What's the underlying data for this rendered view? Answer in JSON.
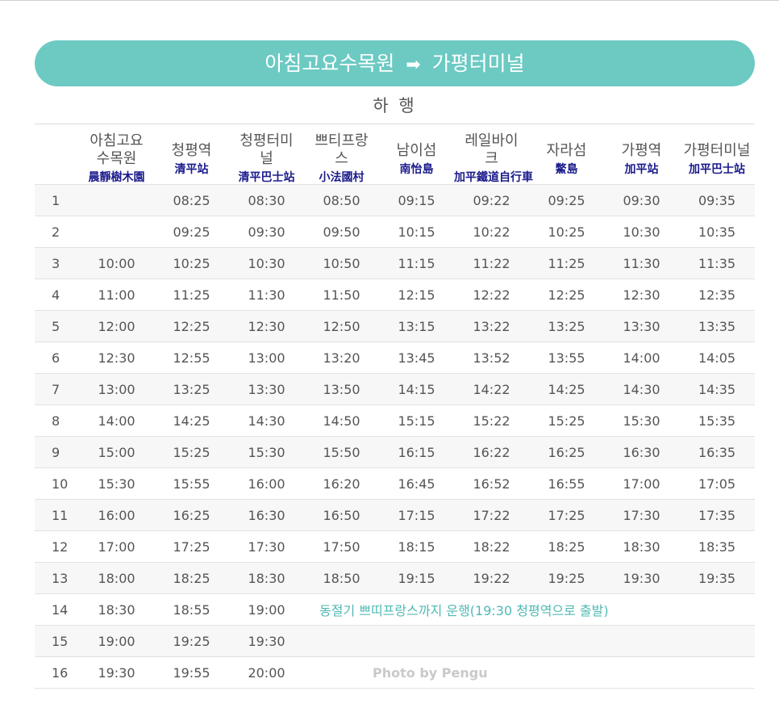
{
  "header": {
    "origin": "아침고요수목원",
    "arrow": "➡",
    "destination": "가평터미널",
    "direction": "하 행"
  },
  "stations": [
    {
      "kr": "아침고요수목원",
      "cn": "晨靜樹木園"
    },
    {
      "kr": "청평역",
      "cn": "清平站"
    },
    {
      "kr": "청평터미널",
      "cn": "清平巴士站"
    },
    {
      "kr": "쁘티프랑스",
      "cn": "小法國村"
    },
    {
      "kr": "남이섬",
      "cn": "南怡島"
    },
    {
      "kr": "레일바이크",
      "cn": "加平鐵道自行車"
    },
    {
      "kr": "자라섬",
      "cn": "鱉島"
    },
    {
      "kr": "가평역",
      "cn": "加平站"
    },
    {
      "kr": "가평터미널",
      "cn": "加平巴士站"
    }
  ],
  "station_lines": [
    [
      "아침고요",
      "수목원"
    ],
    [
      "청평역"
    ],
    [
      "청평터미",
      "널"
    ],
    [
      "쁘티프랑",
      "스"
    ],
    [
      "남이섬"
    ],
    [
      "레일바이",
      "크"
    ],
    [
      "자라섬"
    ],
    [
      "가평역"
    ],
    [
      "가평터미널"
    ]
  ],
  "rows": [
    {
      "no": "1",
      "times": [
        "",
        "08:25",
        "08:30",
        "08:50",
        "09:15",
        "09:22",
        "09:25",
        "09:30",
        "09:35"
      ]
    },
    {
      "no": "2",
      "times": [
        "",
        "09:25",
        "09:30",
        "09:50",
        "10:15",
        "10:22",
        "10:25",
        "10:30",
        "10:35"
      ]
    },
    {
      "no": "3",
      "times": [
        "10:00",
        "10:25",
        "10:30",
        "10:50",
        "11:15",
        "11:22",
        "11:25",
        "11:30",
        "11:35"
      ]
    },
    {
      "no": "4",
      "times": [
        "11:00",
        "11:25",
        "11:30",
        "11:50",
        "12:15",
        "12:22",
        "12:25",
        "12:30",
        "12:35"
      ]
    },
    {
      "no": "5",
      "times": [
        "12:00",
        "12:25",
        "12:30",
        "12:50",
        "13:15",
        "13:22",
        "13:25",
        "13:30",
        "13:35"
      ]
    },
    {
      "no": "6",
      "times": [
        "12:30",
        "12:55",
        "13:00",
        "13:20",
        "13:45",
        "13:52",
        "13:55",
        "14:00",
        "14:05"
      ]
    },
    {
      "no": "7",
      "times": [
        "13:00",
        "13:25",
        "13:30",
        "13:50",
        "14:15",
        "14:22",
        "14:25",
        "14:30",
        "14:35"
      ]
    },
    {
      "no": "8",
      "times": [
        "14:00",
        "14:25",
        "14:30",
        "14:50",
        "15:15",
        "15:22",
        "15:25",
        "15:30",
        "15:35"
      ]
    },
    {
      "no": "9",
      "times": [
        "15:00",
        "15:25",
        "15:30",
        "15:50",
        "16:15",
        "16:22",
        "16:25",
        "16:30",
        "16:35"
      ]
    },
    {
      "no": "10",
      "times": [
        "15:30",
        "15:55",
        "16:00",
        "16:20",
        "16:45",
        "16:52",
        "16:55",
        "17:00",
        "17:05"
      ]
    },
    {
      "no": "11",
      "times": [
        "16:00",
        "16:25",
        "16:30",
        "16:50",
        "17:15",
        "17:22",
        "17:25",
        "17:30",
        "17:35"
      ]
    },
    {
      "no": "12",
      "times": [
        "17:00",
        "17:25",
        "17:30",
        "17:50",
        "18:15",
        "18:22",
        "18:25",
        "18:30",
        "18:35"
      ]
    },
    {
      "no": "13",
      "times": [
        "18:00",
        "18:25",
        "18:30",
        "18:50",
        "19:15",
        "19:22",
        "19:25",
        "19:30",
        "19:35"
      ]
    },
    {
      "no": "14",
      "times": [
        "18:30",
        "18:55",
        "19:00"
      ],
      "note": "동절기 쁘띠프랑스까지 운행(19:30 청평역으로 출발)"
    },
    {
      "no": "15",
      "times": [
        "19:00",
        "19:25",
        "19:30"
      ]
    },
    {
      "no": "16",
      "times": [
        "19:30",
        "19:55",
        "20:00"
      ]
    }
  ],
  "watermark": "Photo by Pengu",
  "colors": {
    "banner": "#6ccac3",
    "note": "#4fb9b3",
    "chinese_names": "#1a1a8c",
    "stripe": "#f7f7f7"
  }
}
